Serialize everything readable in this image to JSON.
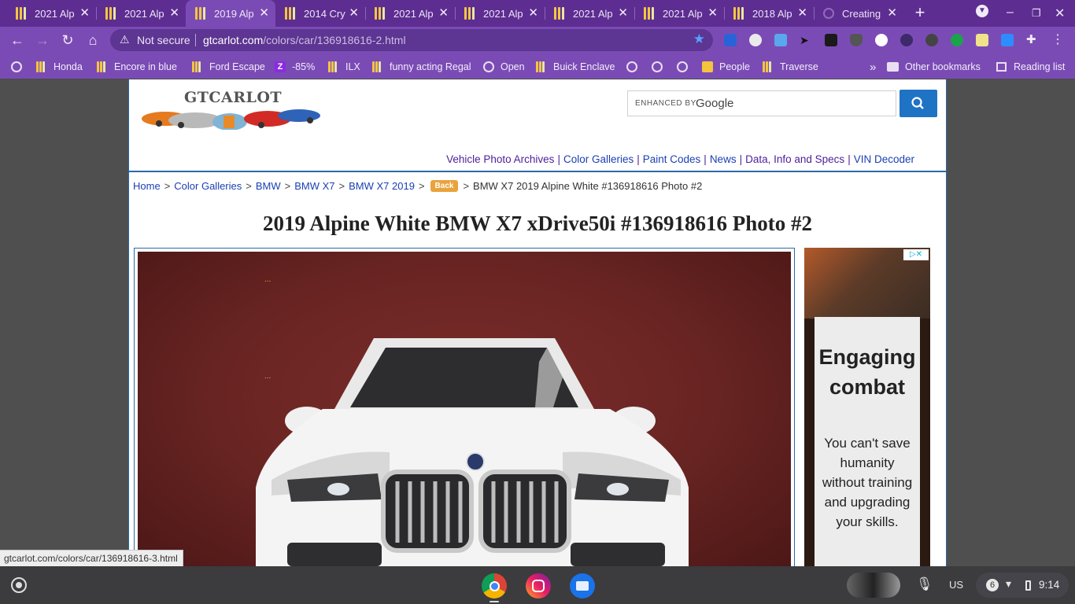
{
  "tabs": [
    {
      "title": "2021 Alp",
      "active": false
    },
    {
      "title": "2021 Alp",
      "active": false
    },
    {
      "title": "2019 Alp",
      "active": true
    },
    {
      "title": "2014 Cry",
      "active": false
    },
    {
      "title": "2021 Alp",
      "active": false
    },
    {
      "title": "2021 Alp",
      "active": false
    },
    {
      "title": "2021 Alp",
      "active": false
    },
    {
      "title": "2021 Alp",
      "active": false
    },
    {
      "title": "2018 Alp",
      "active": false
    },
    {
      "title": "Creating",
      "active": false
    }
  ],
  "omnibox": {
    "security_label": "Not secure",
    "url_host": "gtcarlot.com",
    "url_path": "/colors/car/136918616-2.html"
  },
  "bookmarks": [
    {
      "label": "Honda",
      "icon": "bars-favicon"
    },
    {
      "label": "Encore in blue",
      "icon": "bars-favicon"
    },
    {
      "label": "Ford Escape",
      "icon": "bars-favicon"
    },
    {
      "label": "-85%",
      "icon": "z-favicon"
    },
    {
      "label": "ILX",
      "icon": "bars-favicon"
    },
    {
      "label": "funny acting Regal",
      "icon": "bars-favicon"
    },
    {
      "label": "Open",
      "icon": "globe-icon"
    },
    {
      "label": "Buick Enclave",
      "icon": "bars-favicon"
    },
    {
      "label": "",
      "icon": "globe-icon"
    },
    {
      "label": "",
      "icon": "globe-icon"
    },
    {
      "label": "",
      "icon": "globe-icon"
    },
    {
      "label": "People",
      "icon": "people-favicon"
    },
    {
      "label": "Traverse",
      "icon": "bars-favicon"
    }
  ],
  "bookmarks_overflow": "»",
  "other_bookmarks": "Other bookmarks",
  "reading_list": "Reading list",
  "site": {
    "logo_text": "GTCARLOT",
    "search_prefix": "ENHANCED BY",
    "search_brand": "Google",
    "nav_links": [
      "Vehicle Photo Archives",
      "Color Galleries",
      "Paint Codes",
      "News",
      "Data, Info and Specs",
      "VIN Decoder"
    ],
    "breadcrumb": [
      "Home",
      "Color Galleries",
      "BMW",
      "BMW X7",
      "BMW X7 2019"
    ],
    "back_label": "Back",
    "breadcrumb_current": "BMW X7 2019 Alpine White #136918616 Photo #2",
    "page_title": "2019 Alpine White BMW X7 xDrive50i #136918616 Photo #2",
    "photo_markers": [
      "...",
      "...",
      "..."
    ]
  },
  "ad": {
    "headline": "Engaging combat",
    "body": "You can't save humanity without training and upgrading your skills."
  },
  "status_url": "gtcarlot.com/colors/car/136918616-3.html",
  "shelf": {
    "apps": [
      "chrome-icon",
      "instagram-icon",
      "files-icon"
    ],
    "ime": "US",
    "notifications": "6",
    "time": "9:14"
  },
  "colors": {
    "frame": "#5d2d91",
    "toolbar": "#7b4bb5",
    "link": "#4b1f9a",
    "accent": "#1f73c5",
    "back_button": "#e9a33b",
    "photo_backdrop": "#6a2523"
  }
}
